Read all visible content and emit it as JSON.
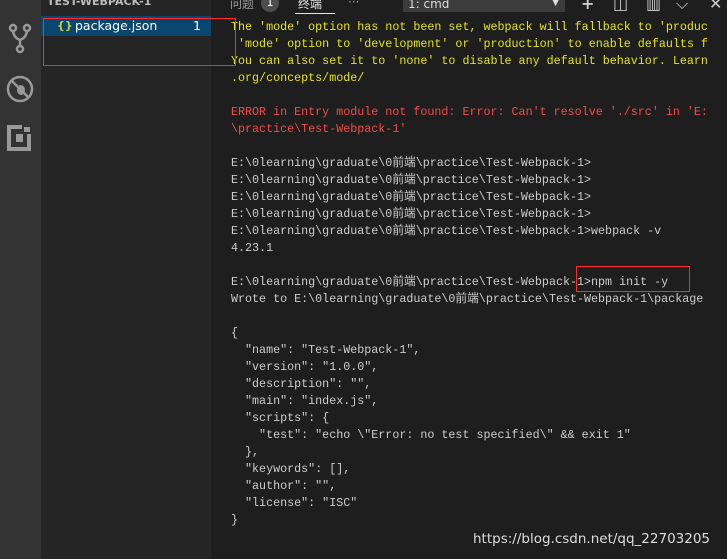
{
  "activity_bar": {
    "icons": [
      "source-control-icon",
      "debug-icon",
      "extensions-icon"
    ]
  },
  "explorer": {
    "folder_title": "TEST-WEBPACK-1",
    "files": [
      {
        "name": "package.json",
        "problems": "1",
        "icon": "json-braces-icon",
        "icon_glyph": "{}"
      }
    ]
  },
  "panel": {
    "tabs": [
      {
        "label": "问题",
        "badge": "1"
      },
      {
        "label": "终端"
      }
    ],
    "more": "···",
    "terminal_select": "1: cmd",
    "actions": [
      "add-icon",
      "split-icon",
      "trash-icon",
      "chevron-icon",
      "close-icon"
    ]
  },
  "terminal": {
    "lines": [
      {
        "t": "The 'mode' option has not been set, webpack will fallback to 'produc",
        "c": "y"
      },
      {
        "t": " 'mode' option to 'development' or 'production' to enable defaults f",
        "c": "y"
      },
      {
        "t": "You can also set it to 'none' to disable any default behavior. Learn",
        "c": "y"
      },
      {
        "t": ".org/concepts/mode/",
        "c": "y"
      },
      {
        "t": "",
        "c": ""
      },
      {
        "t": "ERROR in Entry module not found: Error: Can't resolve './src' in 'E:",
        "c": "r"
      },
      {
        "t": "\\practice\\Test-Webpack-1'",
        "c": "r"
      },
      {
        "t": "",
        "c": ""
      },
      {
        "t": "E:\\0learning\\graduate\\0前端\\practice\\Test-Webpack-1>",
        "c": ""
      },
      {
        "t": "E:\\0learning\\graduate\\0前端\\practice\\Test-Webpack-1>",
        "c": ""
      },
      {
        "t": "E:\\0learning\\graduate\\0前端\\practice\\Test-Webpack-1>",
        "c": ""
      },
      {
        "t": "E:\\0learning\\graduate\\0前端\\practice\\Test-Webpack-1>",
        "c": ""
      },
      {
        "t": "E:\\0learning\\graduate\\0前端\\practice\\Test-Webpack-1>webpack -v",
        "c": ""
      },
      {
        "t": "4.23.1",
        "c": ""
      },
      {
        "t": "",
        "c": ""
      },
      {
        "t": "E:\\0learning\\graduate\\0前端\\practice\\Test-Webpack-1>npm init -y",
        "c": ""
      },
      {
        "t": "Wrote to E:\\0learning\\graduate\\0前端\\practice\\Test-Webpack-1\\package",
        "c": ""
      },
      {
        "t": "",
        "c": ""
      },
      {
        "t": "{",
        "c": ""
      },
      {
        "t": "  \"name\": \"Test-Webpack-1\",",
        "c": ""
      },
      {
        "t": "  \"version\": \"1.0.0\",",
        "c": ""
      },
      {
        "t": "  \"description\": \"\",",
        "c": ""
      },
      {
        "t": "  \"main\": \"index.js\",",
        "c": ""
      },
      {
        "t": "  \"scripts\": {",
        "c": ""
      },
      {
        "t": "    \"test\": \"echo \\\"Error: no test specified\\\" && exit 1\"",
        "c": ""
      },
      {
        "t": "  },",
        "c": ""
      },
      {
        "t": "  \"keywords\": [],",
        "c": ""
      },
      {
        "t": "  \"author\": \"\",",
        "c": ""
      },
      {
        "t": "  \"license\": \"ISC\"",
        "c": ""
      },
      {
        "t": "}",
        "c": ""
      }
    ]
  },
  "watermark": "https://blog.csdn.net/qq_22703205",
  "colors": {
    "warning": "#e5e510",
    "error": "#f14c4c",
    "selection": "#094771",
    "annotation": "#ff2b2b"
  }
}
